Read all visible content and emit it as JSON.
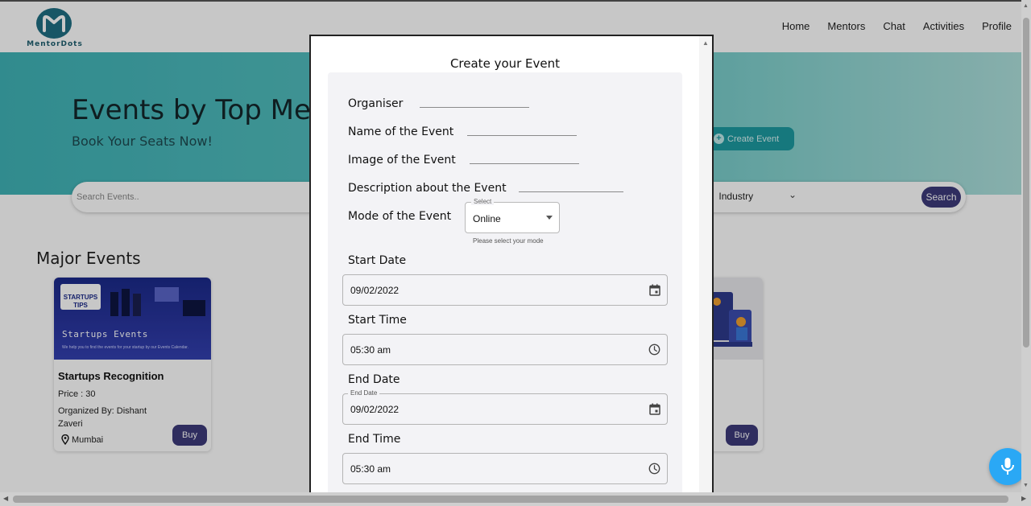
{
  "brand": {
    "name": "MentorDots"
  },
  "nav": {
    "items": [
      "Home",
      "Mentors",
      "Chat",
      "Activities",
      "Profile"
    ]
  },
  "hero": {
    "title": "Events by Top Mentors",
    "subtitle": "Book Your Seats Now!",
    "create_button": "Create Event"
  },
  "search": {
    "placeholder": "Search Events..",
    "filter_label": "Industry",
    "button_label": "Search"
  },
  "events_section": {
    "title": "Major Events",
    "cards": [
      {
        "image_badge": "STARTUPS TIPS",
        "image_title": "Startups Events",
        "image_caption": "We help you to find the events for your startup by our Events Calendar.",
        "name": "Startups Recognition",
        "price": "Price : 30",
        "organizer": "Organized By: Dishant Zaveri",
        "location": "Mumbai",
        "buy_label": "Buy"
      },
      {
        "buy_label": "Buy"
      }
    ]
  },
  "modal": {
    "title": "Create your Event",
    "fields": {
      "organiser": {
        "label": "Organiser",
        "value": ""
      },
      "event_name": {
        "label": "Name of the Event",
        "value": ""
      },
      "event_image": {
        "label": "Image of the Event",
        "value": ""
      },
      "description": {
        "label": "Description about the Event",
        "value": ""
      },
      "mode": {
        "label": "Mode of the Event",
        "legend": "Select",
        "value": "Online",
        "helper": "Please select your mode"
      },
      "start_date": {
        "label": "Start Date",
        "value": "09/02/2022"
      },
      "start_time": {
        "label": "Start Time",
        "value": "05:30 am"
      },
      "end_date": {
        "label": "End Date",
        "legend": "End Date",
        "value": "09/02/2022"
      },
      "end_time": {
        "label": "End Time",
        "value": "05:30 am"
      }
    }
  },
  "colors": {
    "accent_teal": "#3fb3b7",
    "button_purple": "#3d3a7a",
    "mic_blue": "#2aa8f5"
  }
}
